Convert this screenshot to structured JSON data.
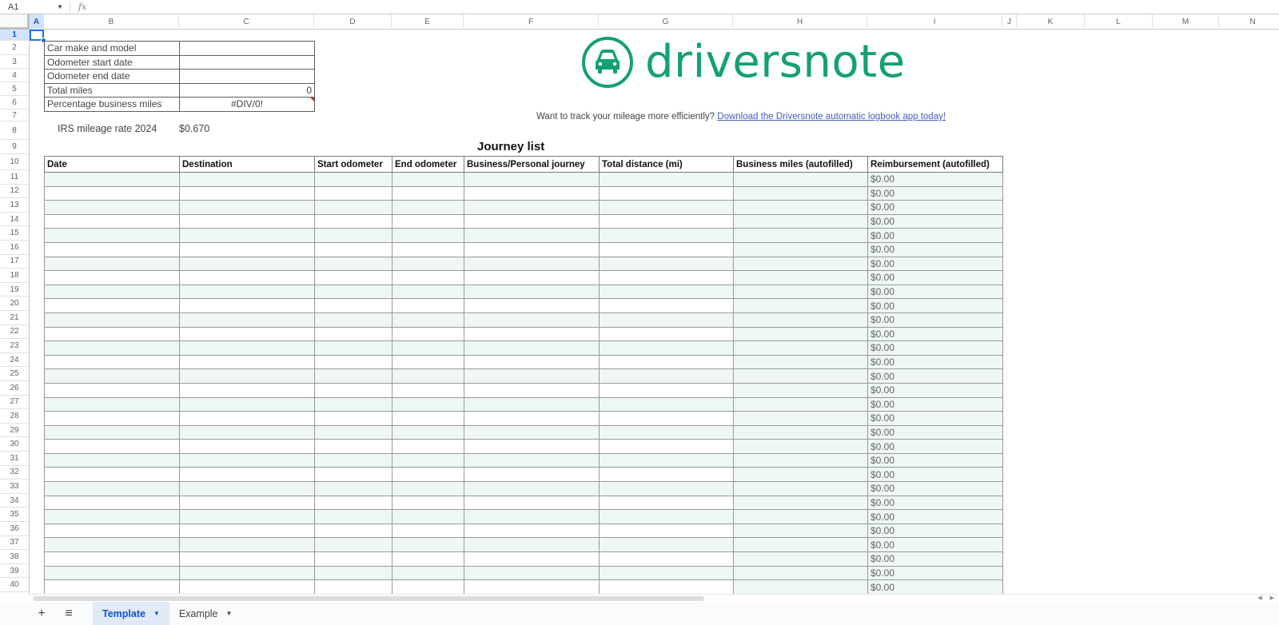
{
  "formula_bar": {
    "cell_ref": "A1",
    "fx_icon": "fx-icon",
    "formula": ""
  },
  "columns": [
    "A",
    "B",
    "C",
    "D",
    "E",
    "F",
    "G",
    "H",
    "I",
    "J",
    "K",
    "L",
    "M",
    "N"
  ],
  "rows": [
    "1",
    "2",
    "3",
    "4",
    "5",
    "6",
    "7",
    "8",
    "9",
    "10",
    "11",
    "12",
    "13",
    "14",
    "15",
    "16",
    "17",
    "18",
    "19",
    "20",
    "21",
    "22",
    "23",
    "24",
    "25",
    "26",
    "27",
    "28",
    "29",
    "30",
    "31",
    "32",
    "33",
    "34",
    "35",
    "36",
    "37",
    "38",
    "39",
    "40"
  ],
  "selected_cell": "A1",
  "info": [
    {
      "label": "Car make and model",
      "value": ""
    },
    {
      "label": "Odometer start date",
      "value": ""
    },
    {
      "label": "Odometer end date",
      "value": ""
    },
    {
      "label": "Total miles",
      "value": "0"
    },
    {
      "label": "Percentage business miles",
      "value": "#DIV/0!"
    }
  ],
  "irs": {
    "label": "IRS mileage rate 2024",
    "value": "$0.670"
  },
  "logo": {
    "icon": "car-icon",
    "text": "driversnote",
    "color": "#13a075"
  },
  "promo": {
    "text": "Want to track your mileage more efficiently?",
    "link": "Download the Driversnote automatic logbook app today!"
  },
  "journey": {
    "title": "Journey list",
    "headers": [
      "Date",
      "Destination",
      "Start odometer",
      "End odometer",
      "Business/Personal journey",
      "Total distance (mi)",
      "Business miles (autofilled)",
      "Reimbursement (autofilled)"
    ],
    "row_count": 30,
    "reimbursement_value": "$0.00"
  },
  "sheet_tabs": {
    "add_label": "+",
    "menu_label": "≡",
    "tabs": [
      {
        "label": "Template",
        "active": true
      },
      {
        "label": "Example",
        "active": false
      }
    ]
  },
  "colors": {
    "accent": "#13a075",
    "tint": "#eef7f6",
    "selection": "#1a73e8"
  }
}
